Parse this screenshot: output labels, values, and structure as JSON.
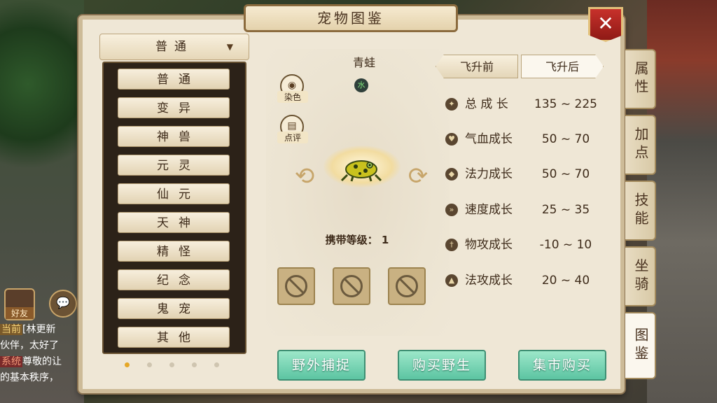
{
  "window": {
    "title": "宠物图鉴",
    "close_label": "✕"
  },
  "filter": {
    "selected": "普通",
    "caret": "▼"
  },
  "categories": [
    {
      "label": "普通"
    },
    {
      "label": "变异"
    },
    {
      "label": "神兽"
    },
    {
      "label": "元灵"
    },
    {
      "label": "仙元"
    },
    {
      "label": "天神"
    },
    {
      "label": "精怪"
    },
    {
      "label": "纪念"
    },
    {
      "label": "鬼宠"
    },
    {
      "label": "其他"
    }
  ],
  "pager": {
    "pages": 5,
    "current": 1
  },
  "pet": {
    "name": "青蛙",
    "element": "水",
    "actions": [
      {
        "label": "染色",
        "icon": "eye-icon"
      },
      {
        "label": "点评",
        "icon": "comment-icon"
      }
    ],
    "carry_level_label": "携带等级：",
    "carry_level": "1",
    "prev_arrow": "⟲",
    "next_arrow": "⟳"
  },
  "tabs": [
    {
      "label": "飞升前",
      "active": true
    },
    {
      "label": "飞升后",
      "active": false
    }
  ],
  "stats": [
    {
      "label": "总 成 长",
      "value": "135 ~ 225",
      "icon": "growth-icon"
    },
    {
      "label": "气血成长",
      "value": "50 ~ 70",
      "icon": "heart-icon"
    },
    {
      "label": "法力成长",
      "value": "50 ~ 70",
      "icon": "mana-icon"
    },
    {
      "label": "速度成长",
      "value": "25 ~ 35",
      "icon": "speed-icon"
    },
    {
      "label": "物攻成长",
      "value": "-10 ~ 10",
      "icon": "sword-icon"
    },
    {
      "label": "法攻成长",
      "value": "20 ~ 40",
      "icon": "fire-icon"
    }
  ],
  "buttons": {
    "catch_wild": "野外捕捉",
    "buy_wild": "购买野生",
    "market_buy": "集市购买"
  },
  "side_tabs": [
    {
      "label": "属性",
      "active": false
    },
    {
      "label": "加点",
      "active": false
    },
    {
      "label": "技能",
      "active": false
    },
    {
      "label": "坐骑",
      "active": false
    },
    {
      "label": "图鉴",
      "active": true
    }
  ],
  "hud": {
    "friend_label": "好友",
    "chat": [
      {
        "tag": "当前",
        "text": "[林更新"
      },
      {
        "tag": "",
        "text": "伙伴，太好了"
      },
      {
        "tag": "系统",
        "text": "尊敬的让"
      },
      {
        "tag": "",
        "text": "的基本秩序，"
      }
    ]
  },
  "colors": {
    "accent_green": "#5cc4a2",
    "panel_bg": "#efe7d6",
    "close_red": "#c7312b",
    "page_dot_active": "#e5a726"
  }
}
